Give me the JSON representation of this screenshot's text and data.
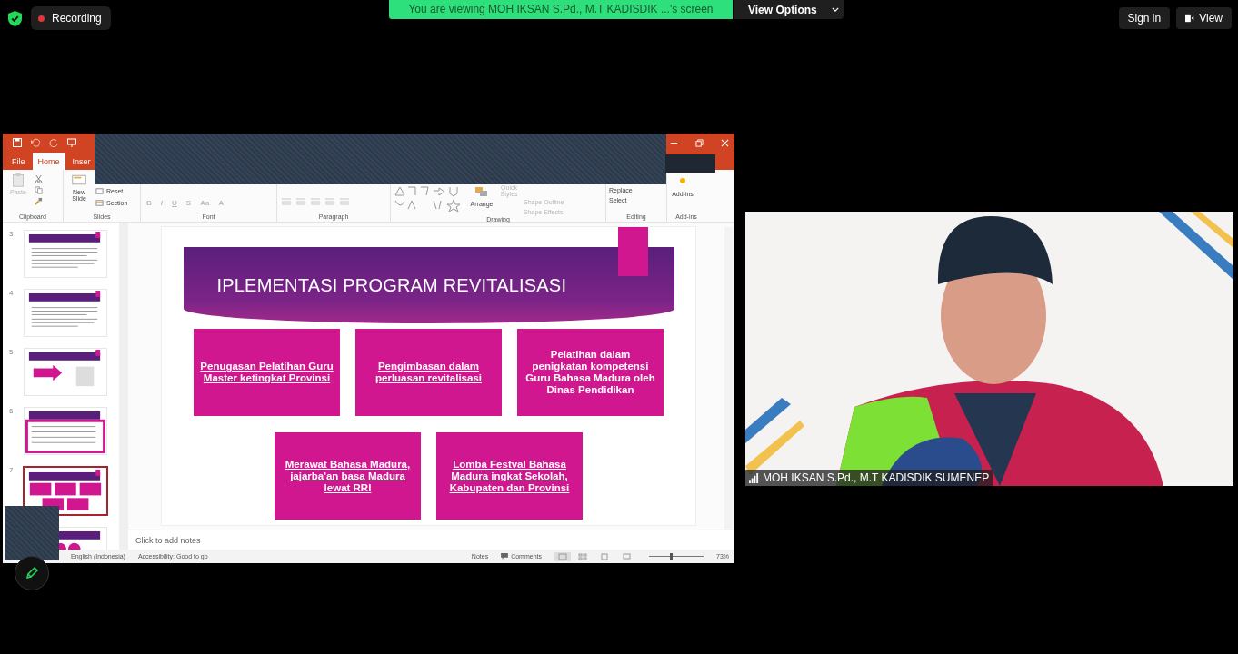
{
  "top_bar": {
    "recording": "Recording",
    "banner": "You are viewing MOH IKSAN S.Pd., M.T KADISDIK ...'s screen",
    "view_options": "View Options",
    "sign_in": "Sign in",
    "view": "View"
  },
  "powerpoint": {
    "tabs": [
      {
        "label": "File",
        "selected": false
      },
      {
        "label": "Home",
        "selected": true
      },
      {
        "label": "Inser",
        "selected": false
      }
    ],
    "ribbon": {
      "clipboard": {
        "label": "Clipboard",
        "paste": {
          "label": "Paste",
          "disabled": true
        }
      },
      "slides": {
        "label": "Slides",
        "new_slide": "New Slide",
        "reset": "Reset",
        "section": "Section"
      },
      "font": {
        "label": "Font",
        "styles": [
          "B",
          "I",
          "U",
          "S"
        ],
        "case": "Aa",
        "font_color_button": "A"
      },
      "paragraph": {
        "label": "Paragraph"
      },
      "drawing": {
        "label": "Drawing",
        "arrange": "Arrange",
        "quick_styles": {
          "label": "Quick Styles",
          "disabled": true
        },
        "shape_outline": {
          "label": "Shape Outline",
          "disabled": true
        },
        "shape_effects": {
          "label": "Shape Effects",
          "disabled": true
        }
      },
      "editing": {
        "label": "Editing",
        "replace": "Replace",
        "select": "Select"
      },
      "addins": {
        "label": "Add-ins",
        "button": "Add-ins"
      }
    },
    "thumbnails": [
      {
        "number": "3",
        "kind": "text",
        "selected": false
      },
      {
        "number": "4",
        "kind": "text",
        "selected": false
      },
      {
        "number": "5",
        "kind": "arrow",
        "selected": false
      },
      {
        "number": "6",
        "kind": "framed",
        "selected": false
      },
      {
        "number": "7",
        "kind": "boxes",
        "selected": true
      },
      {
        "kind": "circles",
        "selected": false
      }
    ],
    "slide": {
      "title": "IPLEMENTASI PROGRAM REVITALISASI",
      "rows": [
        [
          {
            "text": "Penugasan Pelatihan Guru Master ketingkat Provinsi",
            "underlined": true
          },
          {
            "text": "Pengimbasan dalam perluasan revitalisasi",
            "underlined": true
          },
          {
            "text": "Pelatihan dalam penigkatan kompetensi Guru Bahasa Madura oleh Dinas Pendidikan",
            "underlined": false
          }
        ],
        [
          {
            "text": "Merawat Bahasa Madura, jajarba'an basa Madura lewat RRI",
            "underlined": true
          },
          {
            "text": "Lomba Festval Bahasa Madura ingkat Sekolah, Kabupaten dan Provinsi",
            "underlined": true
          }
        ]
      ]
    },
    "notes_placeholder": "Click to add notes",
    "status": {
      "language": "English (Indonesia)",
      "accessibility": "Accessibility: Good to go",
      "notes": "Notes",
      "comments": "Comments",
      "zoom": "73%",
      "zoom_slider": {
        "level": 0.4
      }
    }
  },
  "video": {
    "kind": "picture",
    "name": "MOH IKSAN S.Pd., M.T KADISDIK SUMENEP"
  }
}
